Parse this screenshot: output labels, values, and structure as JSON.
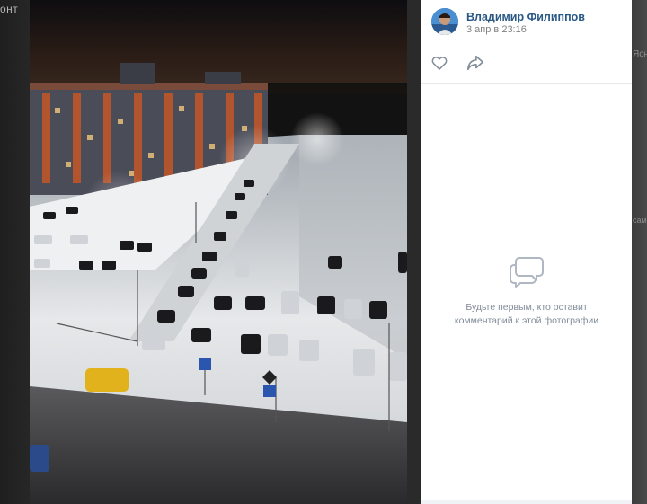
{
  "background": {
    "left_text": "онт",
    "right_text_1": "Ясн",
    "right_text_2": "сам"
  },
  "photo": {
    "description_icon": "night-parking-photo"
  },
  "panel": {
    "author_name": "Владимир Филиппов",
    "date": "3 апр в 23:16",
    "empty_comments_text": "Будьте первым, кто оставит комментарий к этой фотографии"
  },
  "icons": {
    "like": "heart-icon",
    "share": "share-arrow-icon",
    "comments": "comment-bubble-icon"
  },
  "colors": {
    "author_link": "#2a5885",
    "muted_text": "#818c99",
    "date_text": "#828282"
  }
}
